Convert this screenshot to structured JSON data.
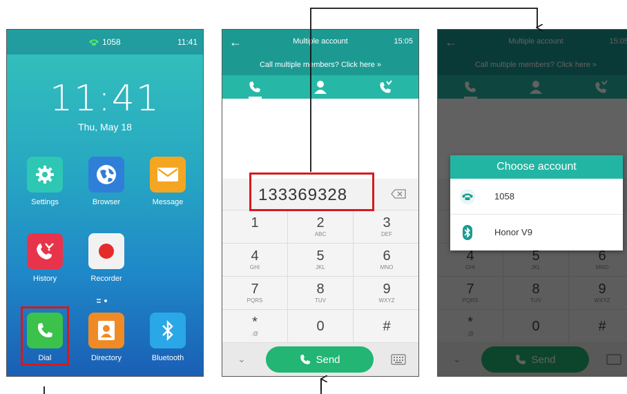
{
  "home": {
    "account": "1058",
    "status_time": "11:41",
    "clock": "11:41",
    "date": "Thu, May 18",
    "apps": [
      {
        "label": "Settings",
        "icon": "settings-gear-icon",
        "color": "#2ec7b4"
      },
      {
        "label": "Browser",
        "icon": "globe-icon",
        "color": "#2f7fd8"
      },
      {
        "label": "Message",
        "icon": "envelope-icon",
        "color": "#f4a623"
      },
      {
        "label": "History",
        "icon": "missed-call-icon",
        "color": "#e8344a"
      },
      {
        "label": "Recorder",
        "icon": "record-icon",
        "color": "#f2f2f2"
      },
      {
        "label": "Dial",
        "icon": "phone-handset-icon",
        "color": "#3bc24b"
      },
      {
        "label": "Directory",
        "icon": "contact-card-icon",
        "color": "#f08a24"
      },
      {
        "label": "Bluetooth",
        "icon": "bluetooth-icon",
        "color": "#2aa7e6"
      }
    ]
  },
  "dialer": {
    "title": "Multiple account",
    "time": "15:05",
    "banner": "Call multiple members? Click here  »",
    "number": "133369328",
    "keys": [
      {
        "d": "1",
        "l": ""
      },
      {
        "d": "2",
        "l": "ABC"
      },
      {
        "d": "3",
        "l": "DEF"
      },
      {
        "d": "4",
        "l": "GHI"
      },
      {
        "d": "5",
        "l": "JKL"
      },
      {
        "d": "6",
        "l": "MNO"
      },
      {
        "d": "7",
        "l": "PQRS"
      },
      {
        "d": "8",
        "l": "TUV"
      },
      {
        "d": "9",
        "l": "WXYZ"
      },
      {
        "d": "*",
        "l": ".@"
      },
      {
        "d": "0",
        "l": ""
      },
      {
        "d": "#",
        "l": ""
      }
    ],
    "send_label": "Send"
  },
  "choose_account": {
    "title": "Choose account",
    "options": [
      {
        "label": "1058",
        "icon": "phone-account-icon"
      },
      {
        "label": "Honor V9",
        "icon": "bluetooth-icon"
      }
    ]
  },
  "colors": {
    "accent": "#1c9a92",
    "tab": "#27b7a6",
    "send": "#22b573",
    "highlight": "#d7191c"
  }
}
